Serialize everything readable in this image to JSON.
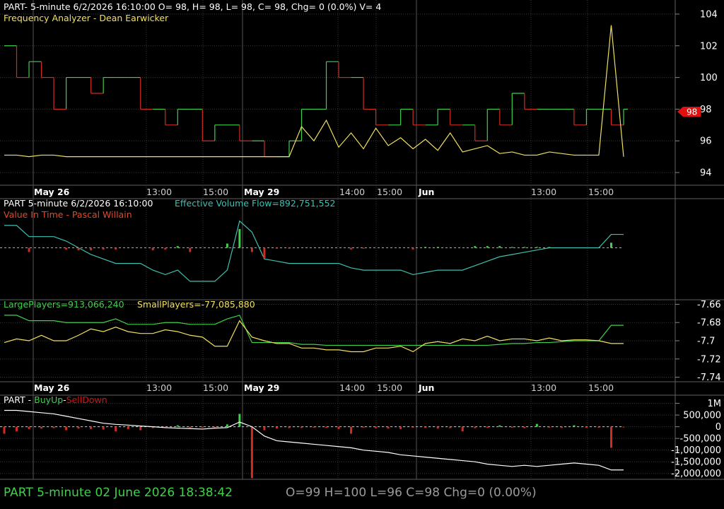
{
  "panels": {
    "p1": {
      "title": "PART- 5-minute 6/2/2026 16:10:00 O= 98, H= 98, L= 98, C= 98, Chg= 0 (0.0%) V= 4",
      "subtitle": "Frequency Analyzer - Dean Earwicker",
      "last_price_tag": "98"
    },
    "p2": {
      "title": "PART 5-minute  6/2/2026 16:10:00",
      "indicator": "Effective Volume Flow=892,751,552",
      "subtitle": "Value In Time - Pascal Willain"
    },
    "p3": {
      "large_players": "LargePlayers=913,066,240",
      "small_players": "SmallPlayers=-77,085,880"
    },
    "p4": {
      "prefix": "PART - ",
      "buy_up": "BuyUp",
      "sep": "-",
      "sell_down": "SellDown"
    }
  },
  "time_labels": [
    "May 26",
    "13:00",
    "15:00",
    "May 29",
    "14:00",
    "15:00",
    "Jun",
    "13:00",
    "15:00"
  ],
  "status": {
    "left": "PART  5-minute   02 June 2026 18:38:42",
    "right": "O=99  H=100  L=96  C=98  Chg=0 (0.00%)"
  },
  "colors": {
    "background": "#000000",
    "grid": "#3a3a3a",
    "up": "#3fd14a",
    "down": "#d12b22",
    "yellow": "#f0e060",
    "cyan": "#40c0b0",
    "white": "#ffffff",
    "tag": "#e01010"
  },
  "chart_data": [
    {
      "type": "line",
      "title": "PART- 5-minute 6/2/2026 16:10:00 O= 98, H= 98, L= 98, C= 98, Chg= 0 (0.0%) V= 4",
      "subtitle": "Frequency Analyzer - Dean Earwicker",
      "y_ticks": [
        94,
        96,
        98,
        100,
        102,
        104
      ],
      "ylim": [
        93.2,
        104.8
      ],
      "series": [
        {
          "kind": "price-step",
          "values": [
            102,
            100,
            101,
            100,
            98,
            100,
            100,
            99,
            100,
            100,
            100,
            98,
            98,
            97,
            98,
            98,
            96,
            97,
            97,
            96,
            96,
            95,
            95,
            96,
            98,
            98,
            101,
            100,
            100,
            98,
            97,
            97,
            98,
            97,
            97,
            98,
            97,
            97,
            96,
            98,
            97,
            99,
            98,
            98,
            98,
            98,
            97,
            98,
            98,
            97,
            98
          ]
        },
        {
          "kind": "frequency",
          "values": [
            95.1,
            95.1,
            95.0,
            95.1,
            95.1,
            95.0,
            95.0,
            95.0,
            95.0,
            95.0,
            95.0,
            95.0,
            95.0,
            95.0,
            95.0,
            95.0,
            95.0,
            95.0,
            95.0,
            95.0,
            95.0,
            95.0,
            95.0,
            95.0,
            96.9,
            96.0,
            97.3,
            95.6,
            96.5,
            95.5,
            96.8,
            95.7,
            96.2,
            95.5,
            96.1,
            95.4,
            96.5,
            95.3,
            95.5,
            95.7,
            95.2,
            95.3,
            95.1,
            95.1,
            95.3,
            95.2,
            95.1,
            95.1,
            95.1,
            103.3,
            95.0
          ]
        }
      ]
    },
    {
      "type": "line",
      "title": "PART 5-minute  6/2/2026 16:10:00",
      "series": [
        {
          "name": "Effective Volume Flow",
          "values": [
            1.0,
            1.0,
            0.5,
            0.5,
            0.5,
            0.3,
            0.0,
            -0.3,
            -0.5,
            -0.7,
            -0.7,
            -0.7,
            -1.0,
            -1.2,
            -1.0,
            -1.5,
            -1.5,
            -1.5,
            -1.0,
            1.2,
            0.7,
            -0.5,
            -0.6,
            -0.7,
            -0.7,
            -0.7,
            -0.7,
            -0.7,
            -0.9,
            -1.0,
            -1.0,
            -1.0,
            -1.0,
            -1.2,
            -1.1,
            -1.0,
            -1.0,
            -1.0,
            -0.8,
            -0.6,
            -0.4,
            -0.3,
            -0.2,
            -0.1,
            0.0,
            0.0,
            0.0,
            0.0,
            0.0,
            0.6,
            0.6
          ]
        }
      ]
    },
    {
      "type": "line",
      "y_ticks": [
        -7.66,
        -7.68,
        -7.7,
        -7.72,
        -7.74
      ],
      "ylim": [
        -7.745,
        -7.655
      ],
      "series": [
        {
          "name": "LargePlayers",
          "values": [
            -7.672,
            -7.672,
            -7.678,
            -7.678,
            -7.678,
            -7.68,
            -7.68,
            -7.68,
            -7.68,
            -7.676,
            -7.682,
            -7.682,
            -7.682,
            -7.68,
            -7.68,
            -7.682,
            -7.682,
            -7.682,
            -7.676,
            -7.672,
            -7.702,
            -7.702,
            -7.702,
            -7.702,
            -7.704,
            -7.704,
            -7.705,
            -7.705,
            -7.705,
            -7.705,
            -7.705,
            -7.705,
            -7.705,
            -7.705,
            -7.705,
            -7.705,
            -7.705,
            -7.705,
            -7.705,
            -7.705,
            -7.704,
            -7.703,
            -7.703,
            -7.702,
            -7.702,
            -7.701,
            -7.7,
            -7.7,
            -7.7,
            -7.683,
            -7.683
          ]
        },
        {
          "name": "SmallPlayers",
          "values": [
            -7.702,
            -7.698,
            -7.7,
            -7.694,
            -7.7,
            -7.7,
            -7.694,
            -7.687,
            -7.69,
            -7.685,
            -7.69,
            -7.692,
            -7.692,
            -7.688,
            -7.69,
            -7.694,
            -7.696,
            -7.706,
            -7.706,
            -7.678,
            -7.696,
            -7.7,
            -7.703,
            -7.703,
            -7.708,
            -7.708,
            -7.71,
            -7.71,
            -7.712,
            -7.712,
            -7.708,
            -7.708,
            -7.706,
            -7.712,
            -7.703,
            -7.701,
            -7.703,
            -7.698,
            -7.7,
            -7.695,
            -7.7,
            -7.698,
            -7.698,
            -7.7,
            -7.697,
            -7.7,
            -7.699,
            -7.699,
            -7.7,
            -7.703,
            -7.703
          ]
        }
      ]
    },
    {
      "type": "bar",
      "y_tick_labels": [
        "1M",
        "500,000",
        "0",
        "-500,000",
        "-1,000,000",
        "-1,500,000",
        "-2,000,000"
      ],
      "y_ticks": [
        1000000,
        500000,
        0,
        -500000,
        -1000000,
        -1500000,
        -2000000
      ],
      "ylim": [
        -2250000,
        1350000
      ],
      "series": [
        {
          "name": "BuyUp-SellDown line",
          "values": [
            700000,
            700000,
            650000,
            600000,
            550000,
            450000,
            350000,
            250000,
            150000,
            100000,
            70000,
            30000,
            0,
            -40000,
            -60000,
            -80000,
            -100000,
            -60000,
            -40000,
            200000,
            0,
            -400000,
            -600000,
            -650000,
            -700000,
            -750000,
            -800000,
            -850000,
            -900000,
            -1000000,
            -1050000,
            -1100000,
            -1200000,
            -1250000,
            -1300000,
            -1350000,
            -1400000,
            -1450000,
            -1500000,
            -1600000,
            -1650000,
            -1700000,
            -1650000,
            -1700000,
            -1650000,
            -1600000,
            -1550000,
            -1600000,
            -1650000,
            -1850000,
            -1850000
          ]
        },
        {
          "name": "BuyUp-SellDown bars",
          "values": [
            -300000,
            -200000,
            -100000,
            -80000,
            -60000,
            -150000,
            -80000,
            -100000,
            -120000,
            -200000,
            -100000,
            -150000,
            -60000,
            -50000,
            60000,
            -50000,
            -40000,
            -40000,
            100000,
            550000,
            -2200000,
            -150000,
            -80000,
            -60000,
            -50000,
            -40000,
            -40000,
            -100000,
            -300000,
            -40000,
            -60000,
            -80000,
            -100000,
            -40000,
            -50000,
            -80000,
            -60000,
            -200000,
            -60000,
            -40000,
            60000,
            -40000,
            -60000,
            120000,
            -40000,
            -50000,
            60000,
            -40000,
            -40000,
            -900000,
            -30000
          ]
        }
      ]
    }
  ]
}
